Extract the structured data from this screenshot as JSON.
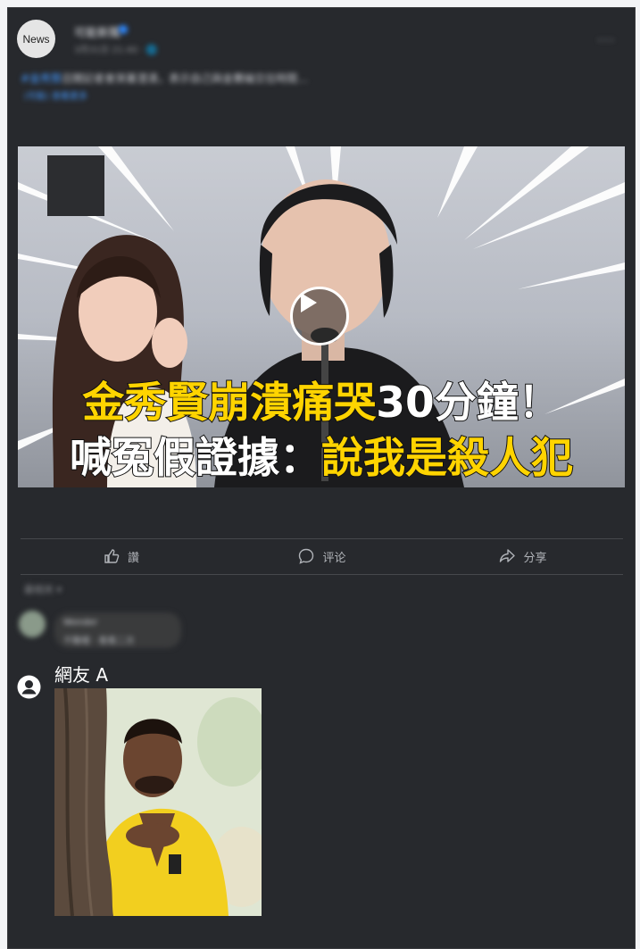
{
  "post": {
    "avatar_label": "News",
    "page_name": "可能新聞",
    "meta": "3月31日 21:40 · 🌐",
    "more": "···",
    "text_tag": "#金秀賢",
    "text_body": "召開記者會哭著澄清，表示自己與金賽綸交往時間… ",
    "see_more": "(可能) 查看更多"
  },
  "video": {
    "headline_line1_yellow": "金秀賢崩潰痛哭",
    "headline_line1_white": "30分鐘！",
    "headline_line2_white": "喊冤假證據：",
    "headline_line2_yellow": "說我是殺人犯"
  },
  "actions": {
    "like": "讚",
    "comment": "评论",
    "share": "分享"
  },
  "comments": {
    "sort": "最相关 ▾",
    "first_name": "Wonder",
    "first_text": "不難喔 · 看看二次",
    "netizen_name": "網友 A"
  },
  "colors": {
    "background": "#27292d",
    "headline_yellow": "#ffd400",
    "link": "#4599ff"
  }
}
